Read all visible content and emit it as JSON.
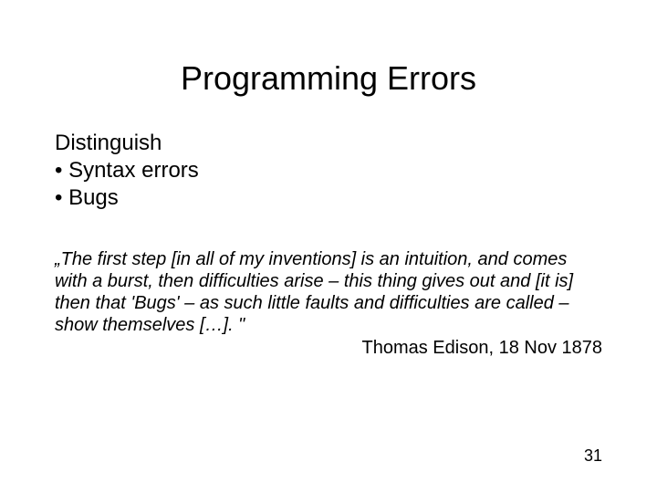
{
  "title": "Programming Errors",
  "body": {
    "line1": "Distinguish",
    "line2": "• Syntax errors",
    "line3": "• Bugs"
  },
  "quote": "„The first step [in all of my inventions] is an intuition, and comes with a burst, then difficulties arise – this thing gives out and [it is] then that 'Bugs' – as such little faults and difficulties are called – show themselves […]. \"",
  "attribution": "Thomas Edison, 18 Nov 1878",
  "page_number": "31"
}
